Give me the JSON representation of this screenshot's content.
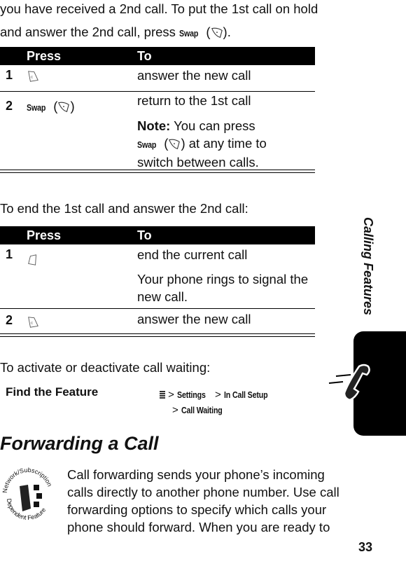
{
  "intro": {
    "line1": "you have received a 2nd call. To put the 1st call on hold",
    "line2_pre": "and answer the 2nd call, press ",
    "swap": "Swap",
    "line2_post": ")."
  },
  "table1": {
    "headers": [
      "Press",
      "To"
    ],
    "rows": [
      {
        "num": "1",
        "key": "send-key-icon",
        "to": "answer the new call"
      },
      {
        "num": "2",
        "press": "Swap",
        "key": "right-soft-key-icon",
        "to": "return to the 1st call",
        "note_label": "Note:",
        "note_1": " You can press",
        "note_swap": "Swap",
        "note_2": ") at any time to",
        "note_3": "switch between calls."
      }
    ]
  },
  "end_intro": "To end the 1st call and answer the 2nd call:",
  "table2": {
    "headers": [
      "Press",
      "To"
    ],
    "rows": [
      {
        "num": "1",
        "key": "end-key-icon",
        "to": "end the current call",
        "extra_1": "Your phone rings to signal the",
        "extra_2": "new call."
      },
      {
        "num": "2",
        "key": "send-key-icon",
        "to": "answer the new call"
      }
    ]
  },
  "activate_intro": "To activate or deactivate call waiting:",
  "find_feature": {
    "label": "Find the Feature",
    "sep": ">",
    "path": [
      "Settings",
      "In Call Setup",
      "Call Waiting"
    ],
    "menu_icon": "menu-key-icon"
  },
  "section_title": "Forwarding a Call",
  "badge": {
    "top": "Network/Subscription",
    "bottom": "Dependent Feature"
  },
  "body": [
    "Call forwarding sends your phone’s incoming",
    "calls directly to another phone number. Use call",
    "forwarding options to specify which calls your",
    "phone should forward. When you are ready to"
  ],
  "side_tab": "Calling Features",
  "page_number": "33"
}
